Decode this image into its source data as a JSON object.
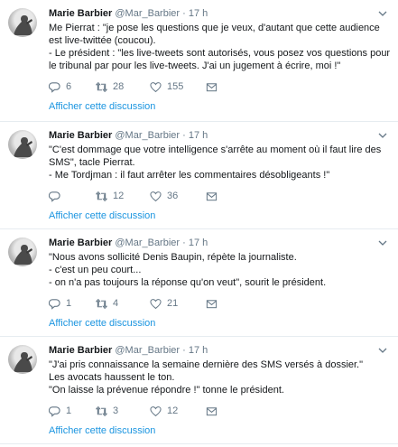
{
  "tweets": [
    {
      "name": "Marie Barbier",
      "handle": "@Mar_Barbier",
      "dot": "·",
      "time": "17 h",
      "text": "Me Pierrat : \"je pose les questions que je veux, d'autant que cette audience est live-twittée (coucou).\n- Le président : \"les live-tweets sont autorisés, vous posez vos questions pour le tribunal par pour les live-tweets. J'ai un jugement à écrire, moi !\"",
      "replies": "6",
      "retweets": "28",
      "likes": "155",
      "thread_link": "Afficher cette discussion"
    },
    {
      "name": "Marie Barbier",
      "handle": "@Mar_Barbier",
      "dot": "·",
      "time": "17 h",
      "text": "\"C'est dommage que votre intelligence s'arrête au moment où il faut lire des SMS\", tacle Pierrat.\n- Me Tordjman : il faut arrêter les commentaires désobligeants !\"",
      "replies": "",
      "retweets": "12",
      "likes": "36",
      "thread_link": "Afficher cette discussion"
    },
    {
      "name": "Marie Barbier",
      "handle": "@Mar_Barbier",
      "dot": "·",
      "time": "17 h",
      "text": "\"Nous avons sollicité Denis Baupin, répète la journaliste.\n- c'est un peu court...\n- on n'a pas toujours la réponse qu'on veut\", sourit le président.",
      "replies": "1",
      "retweets": "4",
      "likes": "21",
      "thread_link": "Afficher cette discussion"
    },
    {
      "name": "Marie Barbier",
      "handle": "@Mar_Barbier",
      "dot": "·",
      "time": "17 h",
      "text": "\"J'ai pris connaissance la semaine dernière des SMS versés à dossier.\"\nLes avocats haussent le ton.\n\"On laisse la prévenue répondre !\" tonne le président.",
      "replies": "1",
      "retweets": "3",
      "likes": "12",
      "thread_link": "Afficher cette discussion"
    }
  ]
}
